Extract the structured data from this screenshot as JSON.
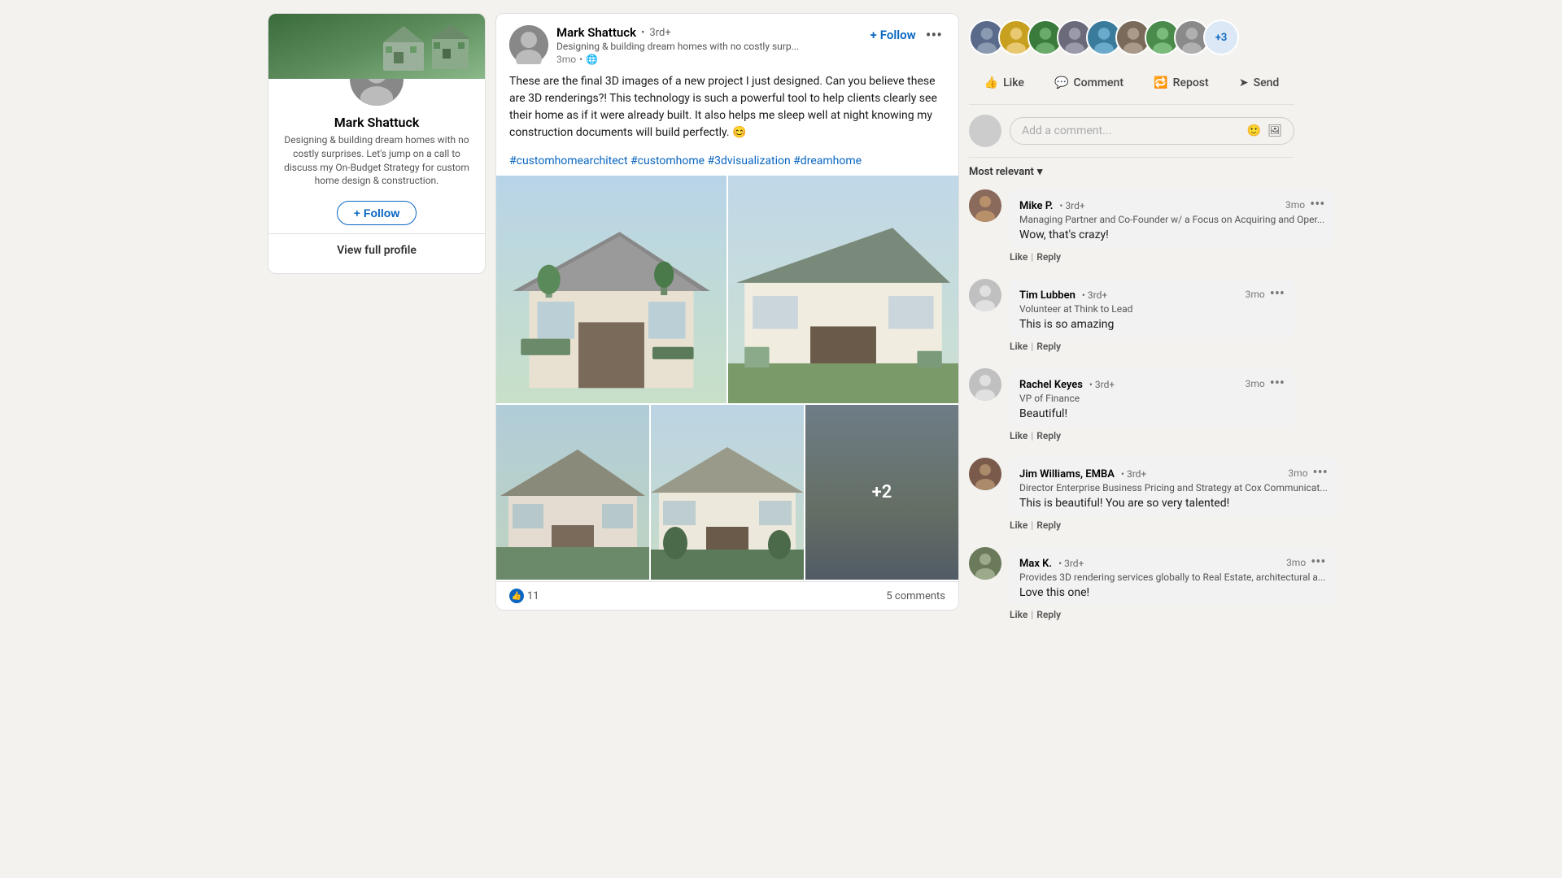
{
  "left_panel": {
    "author_name": "Mark Shattuck",
    "author_bio": "Designing & building dream homes with no costly surprises. Let's jump on a call to discuss my On-Budget Strategy for custom home design & construction.",
    "follow_btn_label": "Follow",
    "view_profile_label": "View full profile"
  },
  "post": {
    "author_name": "Mark Shattuck",
    "author_degree": "3rd+",
    "author_tagline": "Designing & building dream homes with no costly surp...",
    "post_time": "3mo",
    "follow_label": "Follow",
    "body_text": "These are the final 3D images of a new project I just designed. Can you believe these are 3D renderings?! This technology is such a powerful tool to help clients clearly see their home as if it were already built. It also helps me sleep well at night knowing my construction documents will build perfectly. 😊",
    "hashtags": "#customhomearchitect #customhome #3dvisualization #dreamhome",
    "reactions_count": "11",
    "comments_count": "5 comments",
    "image_plus_label": "+2"
  },
  "actions": {
    "like_label": "Like",
    "comment_label": "Comment",
    "repost_label": "Repost",
    "send_label": "Send"
  },
  "comment_input": {
    "placeholder": "Add a comment..."
  },
  "filter": {
    "label": "Most relevant"
  },
  "comments": [
    {
      "author": "Mike P.",
      "degree": "3rd+",
      "role": "Managing Partner and Co-Founder w/ a Focus on Acquiring and Oper...",
      "time": "3mo",
      "text": "Wow, that's crazy!",
      "like_label": "Like",
      "reply_label": "Reply",
      "avatar_color": "#8a6a5a"
    },
    {
      "author": "Tim Lubben",
      "degree": "3rd+",
      "role": "Volunteer at Think to Lead",
      "time": "3mo",
      "text": "This is so amazing",
      "like_label": "Like",
      "reply_label": "Reply",
      "avatar_color": "#c0c0c0"
    },
    {
      "author": "Rachel Keyes",
      "degree": "3rd+",
      "role": "VP of Finance",
      "time": "3mo",
      "text": "Beautiful!",
      "like_label": "Like",
      "reply_label": "Reply",
      "avatar_color": "#c0c0c0"
    },
    {
      "author": "Jim Williams, EMBA",
      "degree": "3rd+",
      "role": "Director Enterprise Business Pricing and Strategy at Cox Communicat...",
      "time": "3mo",
      "text": "This is beautiful! You are so very talented!",
      "like_label": "Like",
      "reply_label": "Reply",
      "avatar_color": "#7a5a4a"
    },
    {
      "author": "Max K.",
      "degree": "3rd+",
      "role": "Provides 3D rendering services globally to Real Estate, architectural a...",
      "time": "3mo",
      "text": "Love this one!",
      "like_label": "Like",
      "reply_label": "Reply",
      "avatar_color": "#6a7a5a"
    }
  ],
  "viewers": [
    {
      "color": "#5a6a8a"
    },
    {
      "color": "#d4a830"
    },
    {
      "color": "#3a7a3a"
    },
    {
      "color": "#6a6a7a"
    },
    {
      "color": "#3a7a9a"
    },
    {
      "color": "#7a6a5a"
    },
    {
      "color": "#4a8a4a"
    },
    {
      "color": "#8a8a8a"
    }
  ],
  "viewers_more": "+3"
}
